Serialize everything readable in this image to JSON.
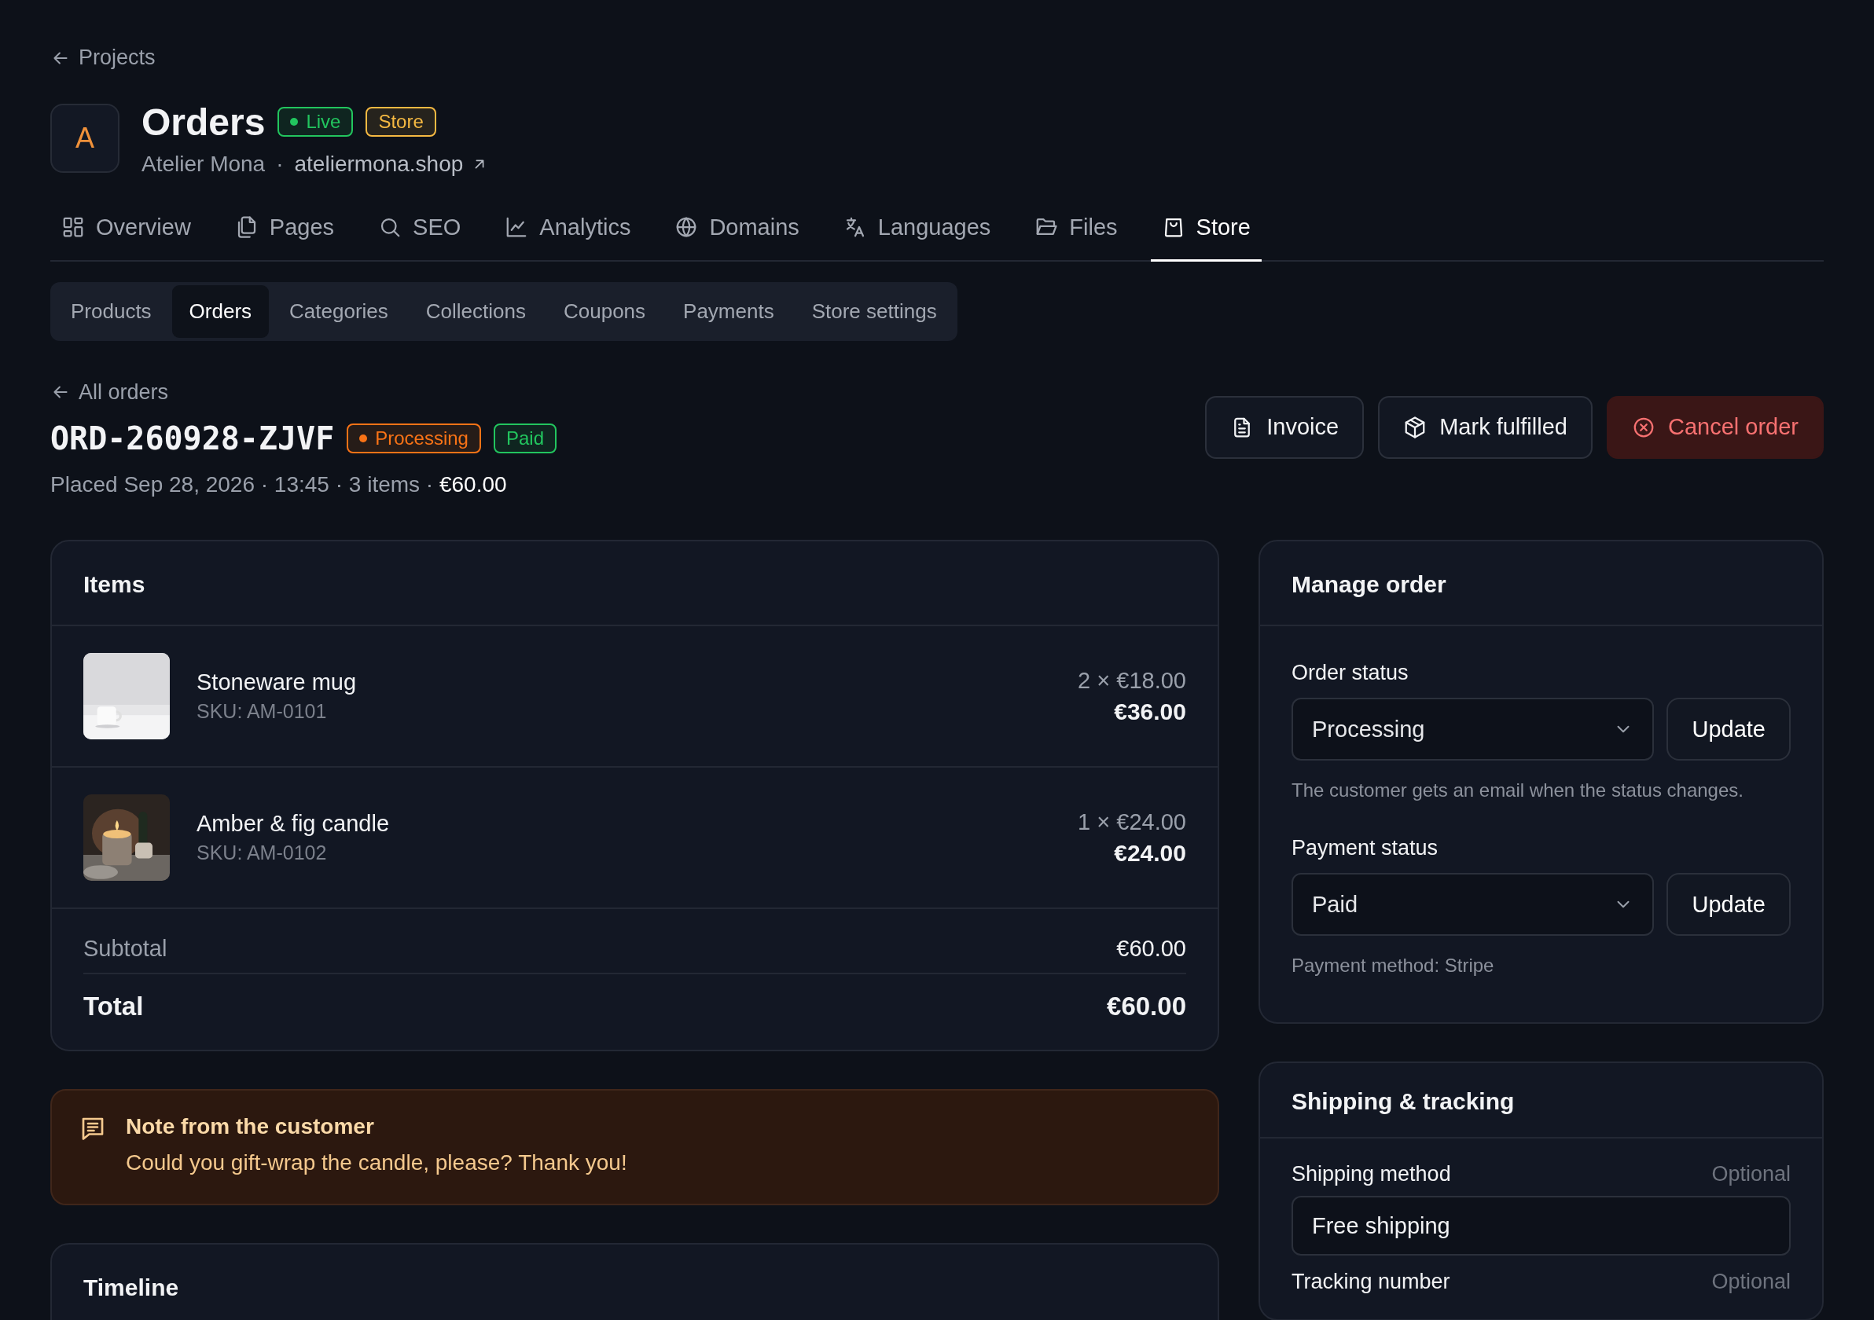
{
  "breadcrumb": {
    "label": "Projects"
  },
  "project": {
    "avatar": "A",
    "title": "Orders",
    "badges": [
      {
        "label": "Live",
        "color": "#22c55e",
        "dot": true
      },
      {
        "label": "Store",
        "color": "#f5b942",
        "dot": false
      }
    ],
    "owner": "Atelier Mona",
    "separator": "·",
    "site": "ateliermona.shop"
  },
  "tabs": [
    {
      "label": "Overview",
      "selected": false
    },
    {
      "label": "Pages",
      "selected": false
    },
    {
      "label": "SEO",
      "selected": false
    },
    {
      "label": "Analytics",
      "selected": false
    },
    {
      "label": "Domains",
      "selected": false
    },
    {
      "label": "Languages",
      "selected": false
    },
    {
      "label": "Files",
      "selected": false
    },
    {
      "label": "Store",
      "selected": true
    }
  ],
  "subtabs": [
    {
      "label": "Products",
      "selected": false
    },
    {
      "label": "Orders",
      "selected": true
    },
    {
      "label": "Categories",
      "selected": false
    },
    {
      "label": "Collections",
      "selected": false
    },
    {
      "label": "Coupons",
      "selected": false
    },
    {
      "label": "Payments",
      "selected": false
    },
    {
      "label": "Store settings",
      "selected": false
    }
  ],
  "order": {
    "back": "All orders",
    "number": "ORD-260928-ZJVF",
    "badges": [
      {
        "label": "Processing",
        "color": "#f97316",
        "dot": true
      },
      {
        "label": "Paid",
        "color": "#22c55e",
        "dot": false
      }
    ],
    "meta": "Placed Sep 28, 2026 · 13:45 · 3 items · **€60.00**"
  },
  "actions": [
    {
      "label": "Invoice",
      "kind": "default"
    },
    {
      "label": "Mark fulfilled",
      "kind": "default"
    },
    {
      "label": "Cancel order",
      "kind": "danger"
    }
  ],
  "items_card": {
    "title": "Items",
    "items": [
      {
        "name": "Stoneware mug",
        "sku": "SKU: AM-0101",
        "qty_price": "2 × €18.00",
        "total": "€36.00"
      },
      {
        "name": "Amber & fig candle",
        "sku": "SKU: AM-0102",
        "qty_price": "1 × €24.00",
        "total": "€24.00"
      }
    ],
    "subtotal": {
      "label": "Subtotal",
      "value": "€60.00"
    },
    "total": {
      "label": "Total",
      "value": "€60.00"
    }
  },
  "note": {
    "title": "Note from the customer",
    "text": "Could you gift-wrap the candle, please? Thank you!"
  },
  "timeline": {
    "title": "Timeline"
  },
  "manage": {
    "title": "Manage order",
    "fields": [
      {
        "label": "Order status",
        "value": "Processing",
        "button": "Update",
        "help": "The customer gets an email when the status changes."
      },
      {
        "label": "Payment status",
        "value": "Paid",
        "button": "Update",
        "help": "Payment method: Stripe"
      }
    ]
  },
  "shipping": {
    "title": "Shipping & tracking",
    "fields": [
      {
        "label": "Shipping method",
        "hint": "Optional",
        "value": "Free shipping"
      },
      {
        "label": "Tracking number",
        "hint": "Optional"
      }
    ]
  }
}
